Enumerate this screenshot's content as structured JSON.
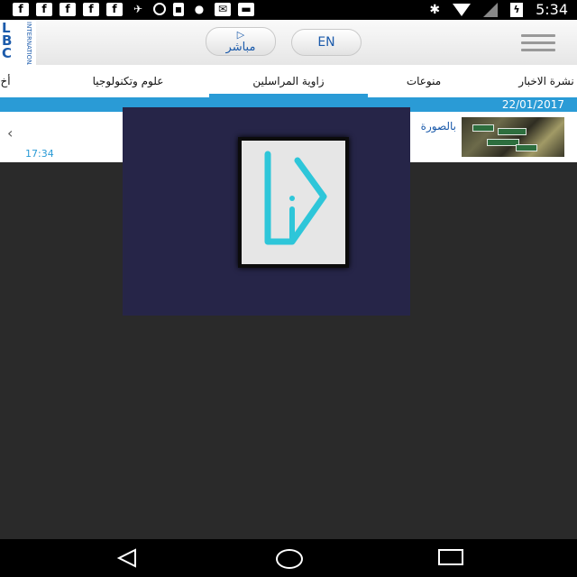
{
  "status_bar": {
    "left_icons": [
      "facebook-icon",
      "facebook-icon",
      "facebook-icon",
      "facebook-icon",
      "facebook-icon",
      "satellite-icon",
      "circle-icon",
      "lock-icon",
      "android-icon",
      "mail-icon",
      "briefcase-icon"
    ],
    "time": "5:34"
  },
  "header": {
    "logo_text": "LBC",
    "logo_sub": "INTERNATIONAL",
    "live_label": "مباشر",
    "en_label": "EN"
  },
  "nav": {
    "tabs": [
      {
        "label": "أخ"
      },
      {
        "label": "علوم وتكنولوجيا"
      },
      {
        "label": "زاوية المراسلين",
        "active": true
      },
      {
        "label": "منوعات"
      },
      {
        "label": "نشرة الاخبار"
      }
    ]
  },
  "date": "22/01/2017",
  "news": {
    "title": "بالصورة",
    "time": "17:34"
  },
  "colors": {
    "accent": "#2a9bd6",
    "brand": "#1c5bab",
    "overlay": "#262548"
  }
}
